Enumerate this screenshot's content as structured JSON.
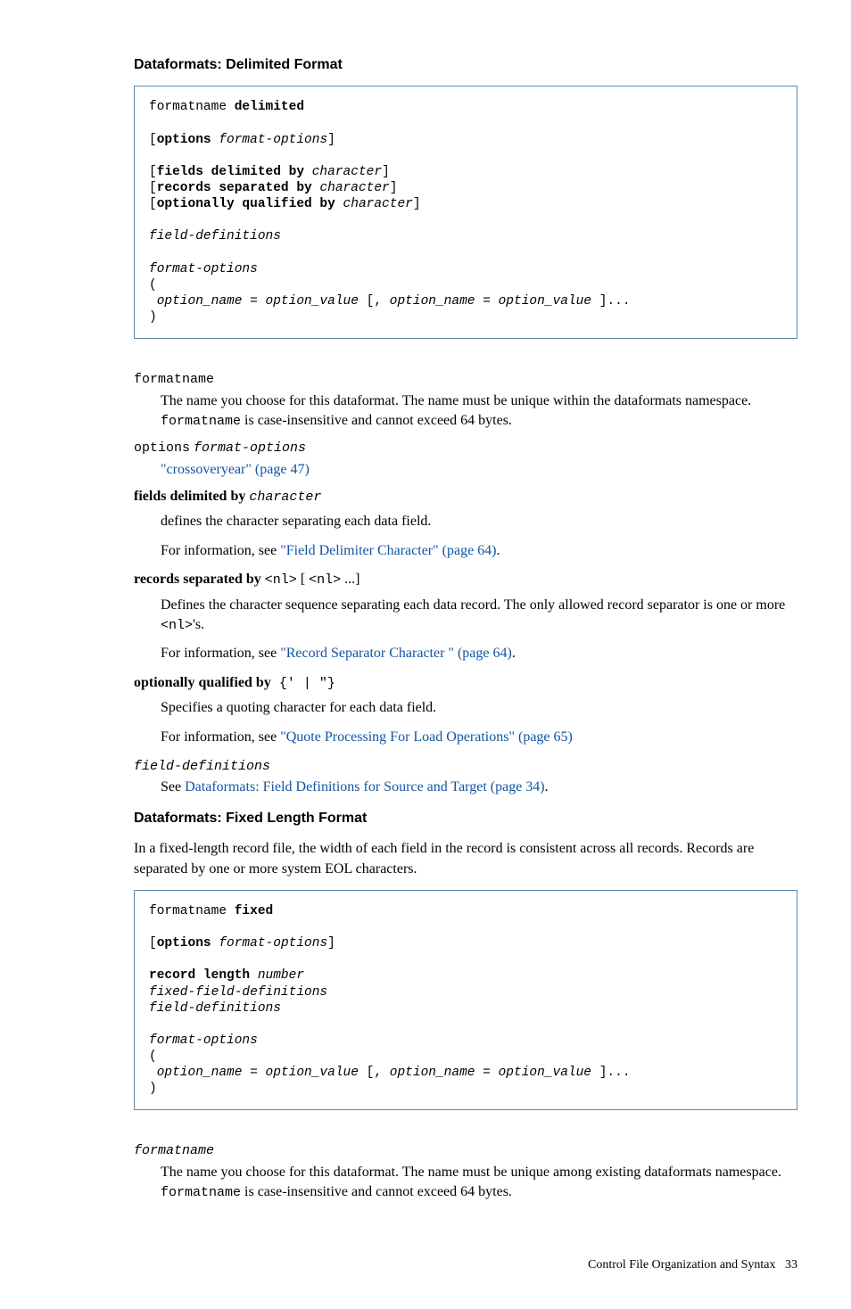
{
  "section1": {
    "heading": "Dataformats: Delimited Format",
    "code_lines": [
      [
        {
          "t": "formatname ",
          "c": ""
        },
        {
          "t": "delimited",
          "c": "kw"
        }
      ],
      [
        {
          "t": "",
          "c": ""
        }
      ],
      [
        {
          "t": "[",
          "c": ""
        },
        {
          "t": "options",
          "c": "kw"
        },
        {
          "t": " ",
          "c": ""
        },
        {
          "t": "format-options",
          "c": "it"
        },
        {
          "t": "]",
          "c": ""
        }
      ],
      [
        {
          "t": "",
          "c": ""
        }
      ],
      [
        {
          "t": "[",
          "c": ""
        },
        {
          "t": "fields delimited by",
          "c": "kw"
        },
        {
          "t": " ",
          "c": ""
        },
        {
          "t": "character",
          "c": "it"
        },
        {
          "t": "]",
          "c": ""
        }
      ],
      [
        {
          "t": "[",
          "c": ""
        },
        {
          "t": "records separated by",
          "c": "kw"
        },
        {
          "t": " ",
          "c": ""
        },
        {
          "t": "character",
          "c": "it"
        },
        {
          "t": "]",
          "c": ""
        }
      ],
      [
        {
          "t": "[",
          "c": ""
        },
        {
          "t": "optionally qualified by",
          "c": "kw"
        },
        {
          "t": " ",
          "c": ""
        },
        {
          "t": "character",
          "c": "it"
        },
        {
          "t": "]",
          "c": ""
        }
      ],
      [
        {
          "t": "",
          "c": ""
        }
      ],
      [
        {
          "t": "field-definitions",
          "c": "it"
        }
      ],
      [
        {
          "t": "",
          "c": ""
        }
      ],
      [
        {
          "t": "format-options",
          "c": "it"
        }
      ],
      [
        {
          "t": "(",
          "c": ""
        }
      ],
      [
        {
          "t": " ",
          "c": ""
        },
        {
          "t": "option_name = option_value",
          "c": "it"
        },
        {
          "t": " [, ",
          "c": ""
        },
        {
          "t": "option_name = option_value",
          "c": "it"
        },
        {
          "t": " ]...",
          "c": ""
        }
      ],
      [
        {
          "t": ")",
          "c": ""
        }
      ]
    ],
    "items": {
      "formatname_term": "formatname",
      "formatname_desc1": "The name you choose for this dataformat. The name must be unique within the dataformats namespace. ",
      "formatname_desc2": " is case-insensitive and cannot exceed 64 bytes.",
      "formatname_inline": "formatname",
      "options_term_kw": "options",
      "options_term_it": "format-options",
      "options_link": "\"crossoveryear\" (page 47)",
      "fields_term_bold": "fields delimited by",
      "fields_term_it": "character",
      "fields_desc": "defines the character separating each data field.",
      "fields_info_prefix": "For information, see ",
      "fields_link": "\"Field Delimiter Character\" (page 64)",
      "fields_period": ".",
      "records_term_bold": "records separated by",
      "records_term_code1": "<nl>",
      "records_term_mid": " [ ",
      "records_term_code2": "<nl>",
      "records_term_tail": " ...]",
      "records_desc1": "Defines the character sequence separating each data record. The only allowed record separator is one or more ",
      "records_desc_code": "<nl>",
      "records_desc2": "'s.",
      "records_info_prefix": "For information, see ",
      "records_link": "\"Record Separator Character \" (page 64)",
      "records_period": ".",
      "opt_term_bold": "optionally qualified by",
      "opt_term_code": " {' | \"}",
      "opt_desc": "Specifies a quoting character for each data field.",
      "opt_info_prefix": "For information, see ",
      "opt_link": "\"Quote Processing For Load Operations\" (page 65)",
      "fd_term": "field-definitions",
      "fd_desc_prefix": "See ",
      "fd_link": "Dataformats: Field Definitions for Source and Target (page 34)",
      "fd_period": "."
    }
  },
  "section2": {
    "heading": "Dataformats: Fixed Length Format",
    "intro": "In a fixed-length record file, the width of each field in the record is consistent across all records. Records are separated by one or more system EOL characters.",
    "code_lines": [
      [
        {
          "t": "formatname ",
          "c": ""
        },
        {
          "t": "fixed",
          "c": "kw"
        }
      ],
      [
        {
          "t": "",
          "c": ""
        }
      ],
      [
        {
          "t": "[",
          "c": ""
        },
        {
          "t": "options",
          "c": "kw"
        },
        {
          "t": " ",
          "c": ""
        },
        {
          "t": "format-options",
          "c": "it"
        },
        {
          "t": "]",
          "c": ""
        }
      ],
      [
        {
          "t": "",
          "c": ""
        }
      ],
      [
        {
          "t": "record length",
          "c": "kw"
        },
        {
          "t": " ",
          "c": ""
        },
        {
          "t": "number",
          "c": "it"
        }
      ],
      [
        {
          "t": "fixed-field-definitions",
          "c": "it"
        }
      ],
      [
        {
          "t": "field-definitions",
          "c": "it"
        }
      ],
      [
        {
          "t": "",
          "c": ""
        }
      ],
      [
        {
          "t": "format-options",
          "c": "it"
        }
      ],
      [
        {
          "t": "(",
          "c": ""
        }
      ],
      [
        {
          "t": " ",
          "c": ""
        },
        {
          "t": "option_name = option_value",
          "c": "it"
        },
        {
          "t": " [, ",
          "c": ""
        },
        {
          "t": "option_name = option_value",
          "c": "it"
        },
        {
          "t": " ]...",
          "c": ""
        }
      ],
      [
        {
          "t": ")",
          "c": ""
        }
      ]
    ],
    "items": {
      "formatname_term": "formatname",
      "formatname_desc1": "The name you choose for this dataformat. The name must be unique among existing dataformats namespace. ",
      "formatname_desc2": " is case-insensitive and cannot exceed 64 bytes.",
      "formatname_inline": "formatname"
    }
  },
  "footer": {
    "text": "Control File Organization and Syntax",
    "page": "33"
  }
}
